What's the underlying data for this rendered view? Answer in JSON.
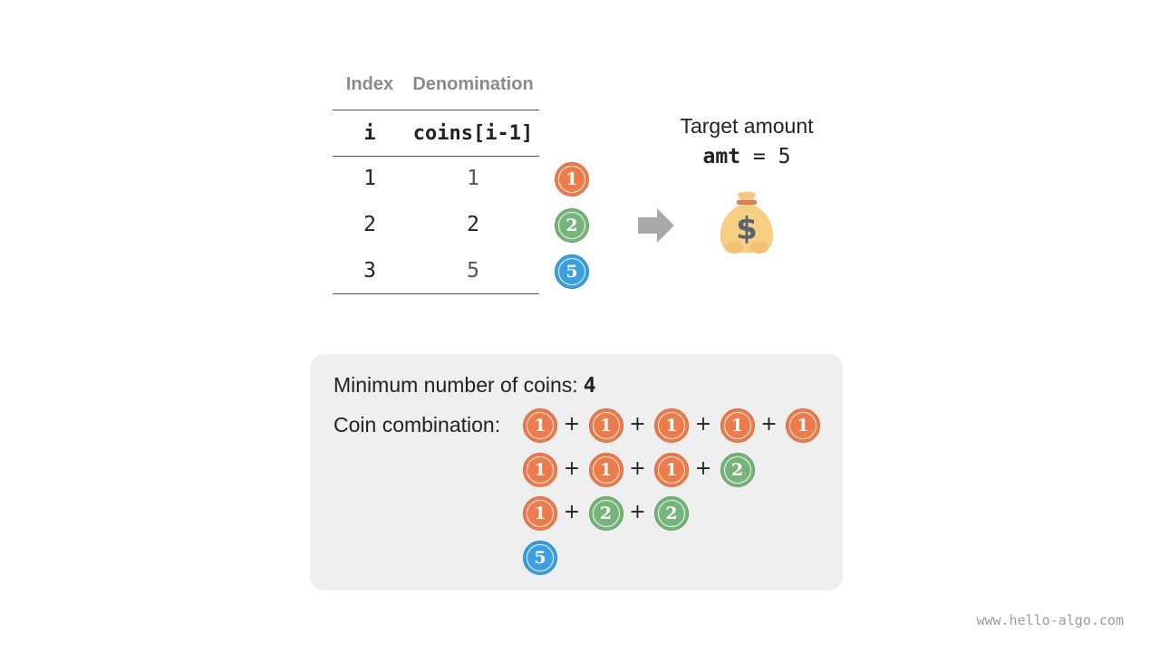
{
  "table": {
    "headers": [
      "Index",
      "Denomination"
    ],
    "subheaders": [
      "i",
      "coins[i-1]"
    ],
    "rows": [
      {
        "index": "1",
        "denomination": "1",
        "coin": "1"
      },
      {
        "index": "2",
        "denomination": "2",
        "coin": "2"
      },
      {
        "index": "3",
        "denomination": "5",
        "coin": "5"
      }
    ]
  },
  "target": {
    "label": "Target amount",
    "var": "amt",
    "eq": "=",
    "value": "5",
    "icon": "money-bag-icon",
    "arrow_icon": "right-arrow-icon"
  },
  "result": {
    "min_label": "Minimum number of coins:",
    "min_value": "4",
    "combo_label": "Coin combination:",
    "combinations": [
      [
        "1",
        "1",
        "1",
        "1",
        "1"
      ],
      [
        "1",
        "1",
        "1",
        "2"
      ],
      [
        "1",
        "2",
        "2"
      ],
      [
        "5"
      ]
    ],
    "plus": "+"
  },
  "colors": {
    "coin_1": "#ee7b4b",
    "coin_2": "#77b47b",
    "coin_5": "#3b9fe2",
    "panel": "#efefef"
  },
  "watermark": "www.hello-algo.com"
}
